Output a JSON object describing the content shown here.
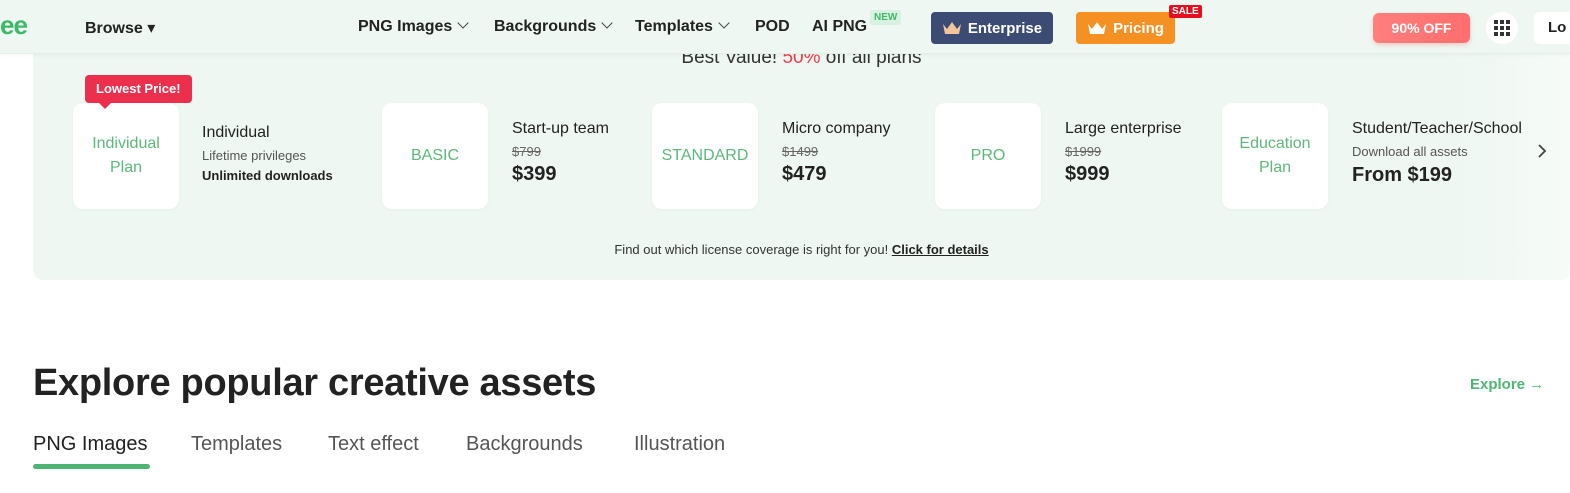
{
  "header": {
    "logo_text": "ee",
    "browse_label": "Browse ▾",
    "nav": [
      {
        "label": "PNG Images"
      },
      {
        "label": "Backgrounds"
      },
      {
        "label": "Templates"
      },
      {
        "label": "POD"
      },
      {
        "label": "AI PNG"
      }
    ],
    "new_badge": "NEW",
    "enterprise_label": "Enterprise",
    "pricing_label": "Pricing",
    "sale_badge": "SALE",
    "discount_label": "90% OFF",
    "login_label": "Lo"
  },
  "plans": {
    "heading_pre": "Best Value! ",
    "heading_accent": "50%",
    "heading_post": " off all plans",
    "lowest_price_tag": "Lowest Price!",
    "items": [
      {
        "card_label": "Individual Plan",
        "name": "Individual",
        "line1": "Lifetime privileges",
        "line2": "Unlimited downloads"
      },
      {
        "card_label": "BASIC",
        "name": "Start-up team",
        "old_price": "$799",
        "price": "$399"
      },
      {
        "card_label": "STANDARD",
        "name": "Micro company",
        "old_price": "$1499",
        "price": "$479"
      },
      {
        "card_label": "PRO",
        "name": "Large enterprise",
        "old_price": "$1999",
        "price": "$999"
      },
      {
        "card_label": "Education Plan",
        "name": "Student/Teacher/School",
        "line1": "Download all assets",
        "price": "From $199"
      }
    ],
    "license_text": "Find out which license coverage is right for you! ",
    "license_link": "Click for details"
  },
  "explore": {
    "title": "Explore popular creative assets",
    "link_label": "Explore →",
    "tabs": [
      "PNG Images",
      "Templates",
      "Text effect",
      "Backgrounds",
      "Illustration"
    ],
    "active_tab": "PNG Images"
  },
  "colors": {
    "brand_green": "#4fb575",
    "sale_red": "#e4101f",
    "enterprise_navy": "#3c4b74",
    "pricing_orange": "#f59122"
  }
}
